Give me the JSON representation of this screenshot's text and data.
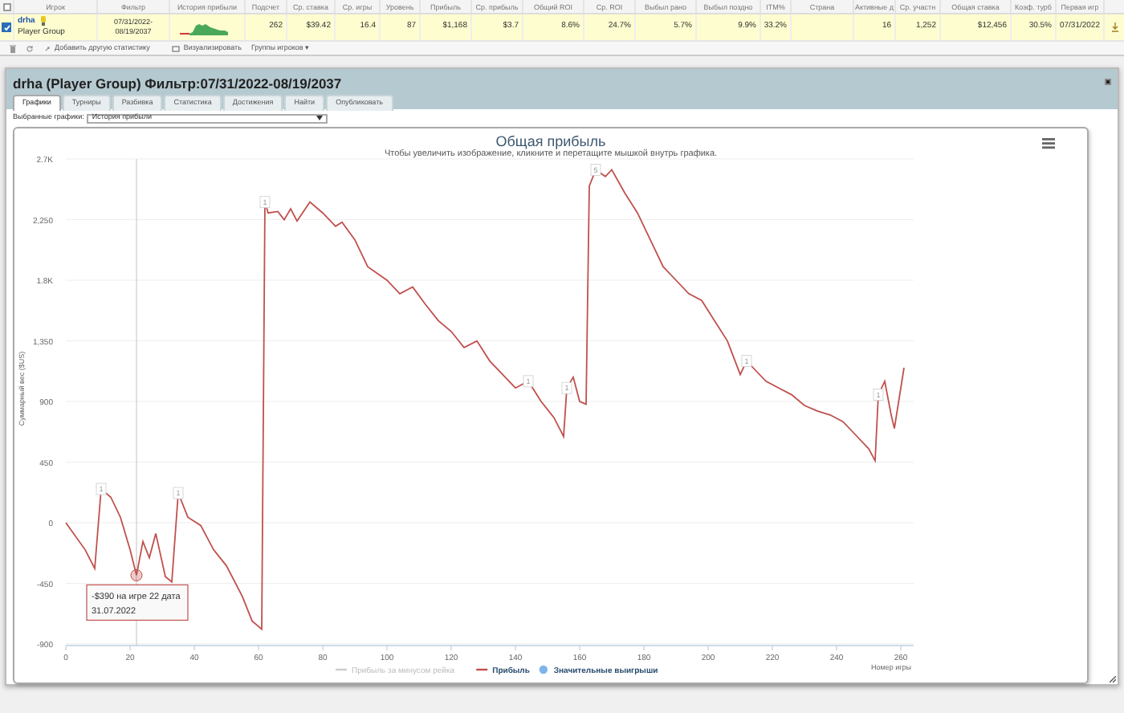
{
  "stats_table": {
    "columns": [
      "Игрок",
      "Фильтр",
      "История прибыли",
      "Подсчет",
      "Ср. ставка",
      "Ср. игры",
      "Уровень",
      "Прибыль",
      "Ср. прибыль",
      "Общий ROI",
      "Ср. ROI",
      "Выбыл рано",
      "Выбыл поздно",
      "ITM%",
      "Страна",
      "Активные д",
      "Ср. участн",
      "Общая ставка",
      "Коэф. турб",
      "Первая игр"
    ],
    "rows": [
      {
        "selected": true,
        "player": "drha",
        "group": "Player Group",
        "filter": "07/31/2022-08/19/2037",
        "values": [
          "262",
          "$39.42",
          "16.4",
          "87",
          "$1,168",
          "$3.7",
          "8.6%",
          "24.7%",
          "5.7%",
          "9.9%",
          "33.2%",
          "16",
          "1,252",
          "$12,456",
          "30.5%",
          "07/31/2022"
        ]
      }
    ],
    "all_selected": false,
    "toolbar": [
      "Добавить другую статистику",
      "Визуализировать",
      "Группы игроков ▾"
    ]
  },
  "dialog": {
    "title": "drha (Player Group) Фильтр:07/31/2022-08/19/2037",
    "tabs": [
      {
        "label": "Графики",
        "selected": true
      },
      {
        "label": "Турниры",
        "selected": false
      },
      {
        "label": "Разбивка",
        "selected": false
      },
      {
        "label": "Статистика",
        "selected": false
      },
      {
        "label": "Достижения",
        "selected": false
      },
      {
        "label": "Найти",
        "selected": false
      },
      {
        "label": "Опубликовать",
        "selected": false
      }
    ],
    "chart_select": {
      "label": "Выбранные графики:",
      "value": "История прибыли"
    },
    "chart": {
      "subtitle": "Чтобы увеличить изображение, кликните и перетащите мышкой внутрь графика.",
      "tooltip": {
        "line1": "-$390 на игре 22 дата",
        "line2": "31.07.2022"
      },
      "legend": [
        {
          "label": "Прибыль за минусом рейка",
          "kind": "line",
          "color": "#cccccc"
        },
        {
          "kind": "series"
        },
        {
          "label": "Значительные выигрыши",
          "kind": "dot",
          "color": "#7cb5ec"
        }
      ],
      "chart_data": {
        "type": "line",
        "title": "Общая прибыль",
        "xlabel": "Номер игры",
        "ylabel": "Суммарный вес ($US)",
        "x": [
          0,
          6,
          9,
          11,
          14,
          17,
          20,
          22,
          24,
          26,
          28,
          31,
          33,
          35,
          38,
          42,
          46,
          50,
          55,
          58,
          61,
          62,
          63,
          66,
          68,
          70,
          72,
          76,
          80,
          84,
          86,
          90,
          94,
          100,
          104,
          108,
          112,
          116,
          120,
          124,
          128,
          132,
          136,
          140,
          144,
          148,
          152,
          155,
          156,
          158,
          160,
          162,
          163,
          165,
          168,
          170,
          174,
          178,
          182,
          186,
          190,
          194,
          198,
          202,
          206,
          210,
          212,
          214,
          218,
          222,
          226,
          230,
          234,
          238,
          242,
          246,
          250,
          252,
          253,
          255,
          257,
          258,
          261
        ],
        "series": [
          {
            "name": "Прибыль",
            "color": "#c0504d",
            "values": [
              0,
              -200,
              -340,
              250,
              190,
              40,
              -200,
              -390,
              -140,
              -260,
              -80,
              -400,
              -440,
              220,
              40,
              -20,
              -200,
              -320,
              -550,
              -730,
              -790,
              2380,
              2300,
              2310,
              2250,
              2330,
              2240,
              2380,
              2300,
              2200,
              2230,
              2100,
              1900,
              1800,
              1700,
              1750,
              1620,
              1500,
              1420,
              1300,
              1350,
              1200,
              1100,
              1000,
              1050,
              900,
              780,
              640,
              1000,
              1080,
              900,
              880,
              2500,
              2620,
              2570,
              2620,
              2450,
              2300,
              2100,
              1900,
              1800,
              1700,
              1650,
              1500,
              1350,
              1100,
              1200,
              1150,
              1050,
              1000,
              950,
              870,
              830,
              800,
              750,
              650,
              550,
              460,
              950,
              1050,
              800,
              700,
              1150
            ]
          }
        ],
        "xlim": [
          0,
          265
        ],
        "ylim": [
          -900,
          2700
        ],
        "grid": true,
        "ref_lines": [
          {
            "axis": "x",
            "value": 22,
            "color": "#cccccc"
          }
        ],
        "xticks": [
          0,
          20,
          40,
          60,
          80,
          100,
          120,
          140,
          160,
          180,
          200,
          220,
          240,
          260
        ],
        "yticks": [
          {
            "value": 2700,
            "label": "2.7K"
          },
          {
            "value": 2250,
            "label": "2,250"
          },
          {
            "value": 1800,
            "label": "1.8K"
          },
          {
            "value": 1350,
            "label": "1,350"
          },
          {
            "value": 900,
            "label": "900"
          },
          {
            "value": 450,
            "label": "450"
          },
          {
            "value": 0,
            "label": "0"
          },
          {
            "value": -450,
            "label": "-450"
          },
          {
            "value": -900,
            "label": "-900"
          }
        ],
        "annotations": [
          {
            "x": 11,
            "y": 250,
            "text": "1"
          },
          {
            "x": 35,
            "y": 220,
            "text": "1"
          },
          {
            "x": 62,
            "y": 2380,
            "text": "1"
          },
          {
            "x": 144,
            "y": 1050,
            "text": "1"
          },
          {
            "x": 156,
            "y": 1000,
            "text": "1"
          },
          {
            "x": 165,
            "y": 2620,
            "text": "5"
          },
          {
            "x": 212,
            "y": 1200,
            "text": "1"
          },
          {
            "x": 253,
            "y": 950,
            "text": "1"
          }
        ]
      }
    }
  }
}
